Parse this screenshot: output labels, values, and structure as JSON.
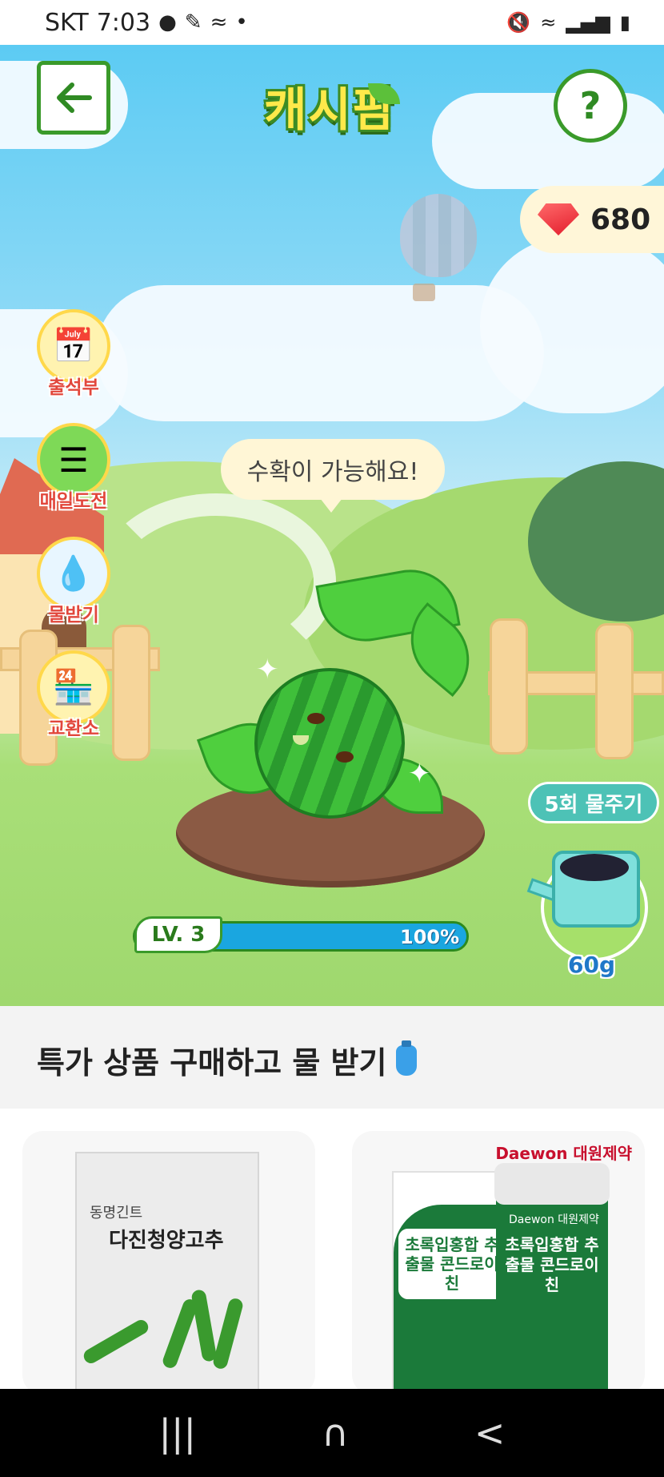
{
  "status_bar": {
    "carrier": "SKT",
    "time": "7:03",
    "left_icons": [
      "messenger-icon",
      "pen-icon",
      "mustache-icon",
      "dot-icon"
    ],
    "right_icons": [
      "mute-icon",
      "wifi-icon",
      "signal-icon",
      "battery-icon"
    ]
  },
  "header": {
    "logo_text": "캐시팜",
    "back_icon": "arrow-left-icon",
    "help_label": "?"
  },
  "gems": {
    "count": "680"
  },
  "side_menu": [
    {
      "label": "출석부",
      "icon": "calendar-icon"
    },
    {
      "label": "매일도전",
      "icon": "checklist-icon"
    },
    {
      "label": "물받기",
      "icon": "water-bottle-icon"
    },
    {
      "label": "교환소",
      "icon": "shop-icon"
    }
  ],
  "speech_bubble": "수확이 가능해요!",
  "level": {
    "label": "LV. 3",
    "progress_text": "100%",
    "progress": 1.0
  },
  "watering": {
    "button_label": "5회 물주기",
    "amount": "60g"
  },
  "shop": {
    "title": "특가 상품 구매하고 물 받기",
    "products": [
      {
        "pack_name": "다진청양고추",
        "pack_brand": "동명긴트"
      },
      {
        "brand": "Daewon 대원제약",
        "box_text": "초록입홍합 추출물 콘드로이친",
        "jar_brand": "Daewon 대원제약",
        "jar_text": "초록입홍합 추출물 콘드로이친"
      }
    ]
  },
  "navbar": {
    "recent": "|||",
    "home": "∩",
    "back": "<"
  }
}
